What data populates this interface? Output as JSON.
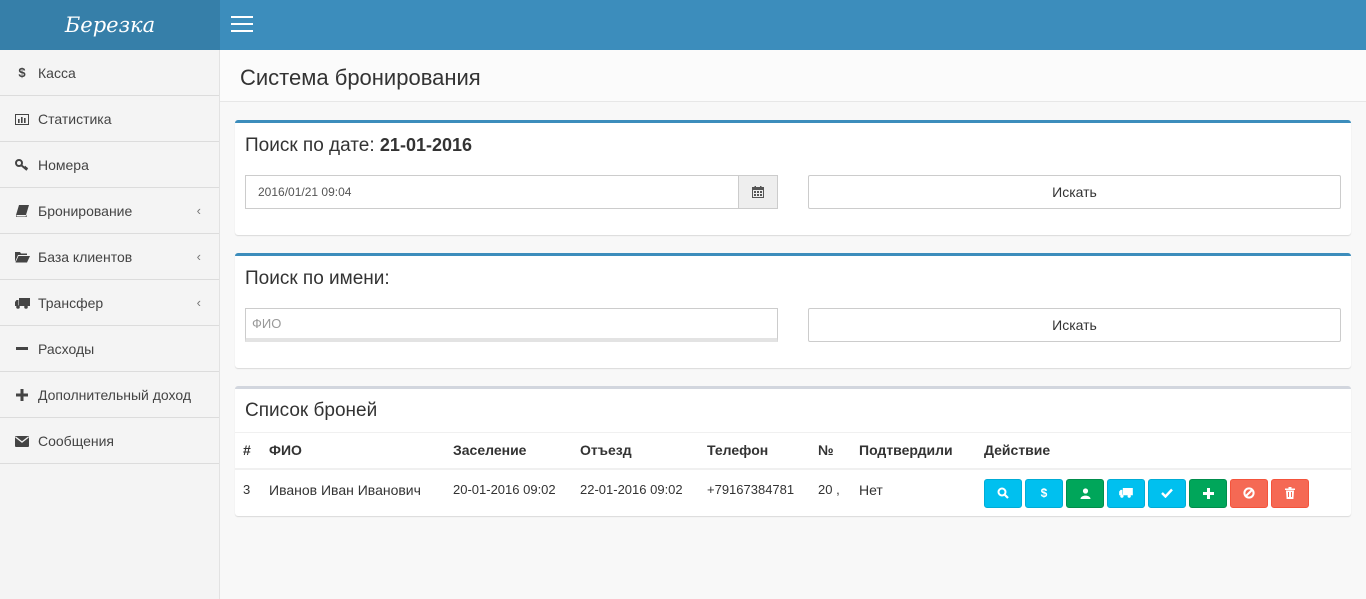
{
  "app": {
    "logo": "Березка"
  },
  "sidebar": {
    "items": [
      {
        "label": "Касса",
        "icon": "dollar-icon",
        "glyph": "$",
        "submenu": false
      },
      {
        "label": "Статистика",
        "icon": "bar-chart-icon",
        "glyph": "",
        "submenu": false
      },
      {
        "label": "Номера",
        "icon": "key-icon",
        "glyph": "",
        "submenu": false
      },
      {
        "label": "Бронирование",
        "icon": "book-icon",
        "glyph": "",
        "submenu": true
      },
      {
        "label": "База клиентов",
        "icon": "folder-open-icon",
        "glyph": "",
        "submenu": true
      },
      {
        "label": "Трансфер",
        "icon": "truck-icon",
        "glyph": "",
        "submenu": true
      },
      {
        "label": "Расходы",
        "icon": "minus-icon",
        "glyph": "━",
        "submenu": false
      },
      {
        "label": "Дополнительный доход",
        "icon": "plus-icon",
        "glyph": "✚",
        "submenu": false
      },
      {
        "label": "Сообщения",
        "icon": "envelope-icon",
        "glyph": "",
        "submenu": false
      }
    ],
    "chevron": "‹"
  },
  "page": {
    "title": "Система бронирования"
  },
  "date_search": {
    "title": "Поиск по дате:",
    "date": "21-01-2016",
    "input_value": "2016/01/21 09:04",
    "button": "Искать"
  },
  "name_search": {
    "title": "Поиск по имени:",
    "placeholder": "ФИО",
    "button": "Искать"
  },
  "bookings": {
    "title": "Список броней",
    "columns": [
      "#",
      "ФИО",
      "Заселение",
      "Отъезд",
      "Телефон",
      "№",
      "Подтвердили",
      "Действие"
    ],
    "rows": [
      {
        "id": "3",
        "name": "Иванов Иван Иванович",
        "checkin": "20-01-2016 09:02",
        "checkout": "22-01-2016 09:02",
        "phone": "+79167384781",
        "room": "20 ,",
        "confirmed": "Нет"
      }
    ],
    "actions": [
      {
        "icon": "search-icon",
        "color": "#00c0ef"
      },
      {
        "icon": "dollar-icon",
        "color": "#00c0ef"
      },
      {
        "icon": "user-icon",
        "color": "#00a65a"
      },
      {
        "icon": "truck-icon",
        "color": "#00c0ef"
      },
      {
        "icon": "check-icon",
        "color": "#00c0ef"
      },
      {
        "icon": "plus-icon",
        "color": "#00a65a"
      },
      {
        "icon": "ban-icon",
        "color": "#f56954"
      },
      {
        "icon": "trash-icon",
        "color": "#f56954"
      }
    ]
  },
  "colors": {
    "header": "#3c8dbc",
    "logo_bg": "#367fa9"
  }
}
